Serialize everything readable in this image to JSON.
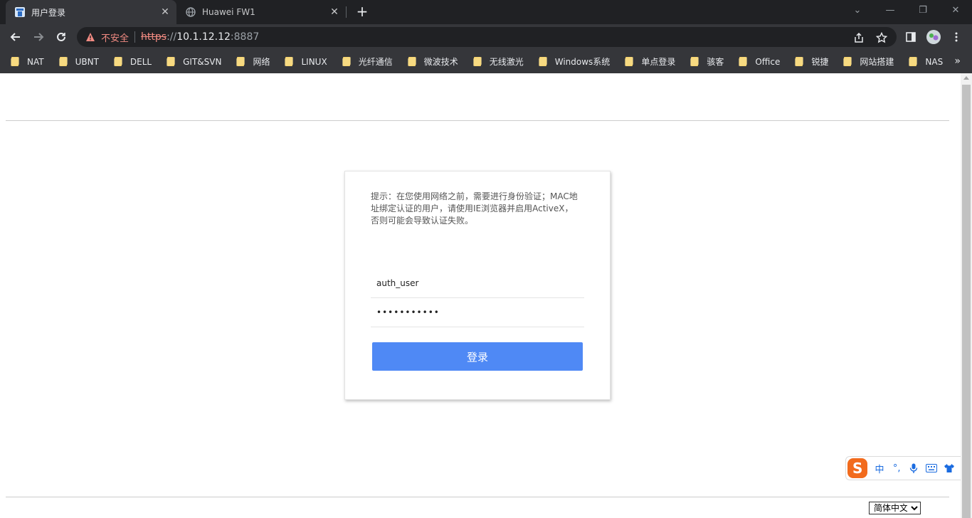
{
  "browser": {
    "tabs": [
      {
        "title": "用户登录",
        "active": true
      },
      {
        "title": "Huawei FW1",
        "active": false
      }
    ],
    "security_label": "不安全",
    "url_scheme": "https",
    "url_sep": "://",
    "url_host": "10.1.12.12",
    "url_port": ":8887",
    "bookmarks": [
      "NAT",
      "UBNT",
      "DELL",
      "GIT&SVN",
      "网络",
      "LINUX",
      "光纤通信",
      "微波技术",
      "无线激光",
      "Windows系统",
      "单点登录",
      "骇客",
      "Office",
      "锐捷",
      "网站搭建",
      "NAS"
    ],
    "more_bookmarks": "»"
  },
  "login": {
    "notice": "提示：在您使用网络之前，需要进行身份验证；MAC地址绑定认证的用户，请使用IE浏览器并启用ActiveX，否则可能会导致认证失败。",
    "username_value": "auth_user",
    "password_value": "•••••••••••",
    "button_label": "登录"
  },
  "ime": {
    "logo": "S",
    "mode": "中",
    "punct": "°,"
  },
  "language": {
    "selected": "简体中文"
  }
}
